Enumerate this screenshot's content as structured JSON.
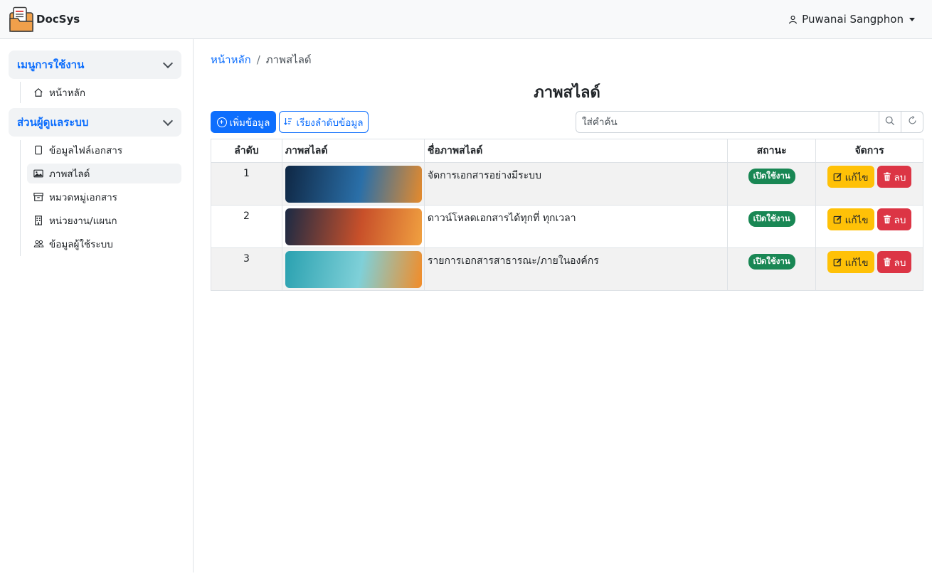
{
  "header": {
    "brand": "DocSys",
    "user_name": "Puwanai Sangphon"
  },
  "sidebar": {
    "sections": [
      {
        "title": "เมนูการใช้งาน",
        "items": [
          {
            "label": "หน้าหลัก",
            "icon": "home-icon"
          }
        ]
      },
      {
        "title": "ส่วนผู้ดูแลระบบ",
        "items": [
          {
            "label": "ข้อมูลไฟล์เอกสาร",
            "icon": "file-icon"
          },
          {
            "label": "ภาพสไลด์",
            "icon": "image-icon",
            "active": true
          },
          {
            "label": "หมวดหมู่เอกสาร",
            "icon": "archive-icon"
          },
          {
            "label": "หน่วยงาน/แผนก",
            "icon": "building-icon"
          },
          {
            "label": "ข้อมูลผู้ใช้ระบบ",
            "icon": "users-icon"
          }
        ]
      }
    ]
  },
  "breadcrumb": {
    "home": "หน้าหลัก",
    "separator": "/",
    "current": "ภาพสไลด์"
  },
  "page_title": "ภาพสไลด์",
  "toolbar": {
    "add_label": "เพิ่มข้อมูล",
    "sort_label": "เรียงลำดับข้อมูล",
    "search_placeholder": "ใส่คำค้น"
  },
  "table": {
    "headers": {
      "no": "ลำดับ",
      "image": "ภาพสไลด์",
      "name": "ชื่อภาพสไลด์",
      "status": "สถานะ",
      "actions": "จัดการ"
    },
    "rows": [
      {
        "no": "1",
        "name": "จัดการเอกสารอย่างมีระบบ",
        "status": "เปิดใช้งาน",
        "edit": "แก้ไข",
        "delete": "ลบ",
        "thumb_colors": [
          "#0f2744",
          "#2a6fa8",
          "#e58a2c"
        ]
      },
      {
        "no": "2",
        "name": "ดาวน์โหลดเอกสารได้ทุกที่ ทุกเวลา",
        "status": "เปิดใช้งาน",
        "edit": "แก้ไข",
        "delete": "ลบ",
        "thumb_colors": [
          "#1b2a44",
          "#c8502a",
          "#f0a040"
        ]
      },
      {
        "no": "3",
        "name": "รายการเอกสารสาธารณะ/ภายในองค์กร",
        "status": "เปิดใช้งาน",
        "edit": "แก้ไข",
        "delete": "ลบ",
        "thumb_colors": [
          "#2aa1b0",
          "#7fd0d8",
          "#f28c28"
        ]
      }
    ]
  },
  "colors": {
    "primary": "#0d6efd",
    "success": "#198754",
    "warning": "#ffc107",
    "danger": "#dc3545"
  }
}
